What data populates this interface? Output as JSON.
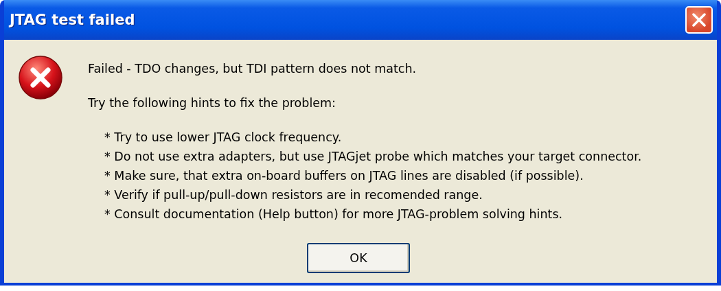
{
  "window": {
    "title": "JTAG test failed"
  },
  "message": "Failed - TDO changes, but TDI pattern does not match.",
  "intro": "Try the following hints to fix the problem:",
  "hints": [
    "* Try to use lower JTAG clock frequency.",
    "* Do not use extra adapters, but use JTAGjet probe which matches your target connector.",
    "* Make sure, that extra on-board buffers on JTAG lines are disabled (if possible).",
    "* Verify if pull-up/pull-down resistors are in recomended range.",
    "* Consult documentation (Help button) for more JTAG-problem solving hints."
  ],
  "buttons": [
    "OK"
  ]
}
